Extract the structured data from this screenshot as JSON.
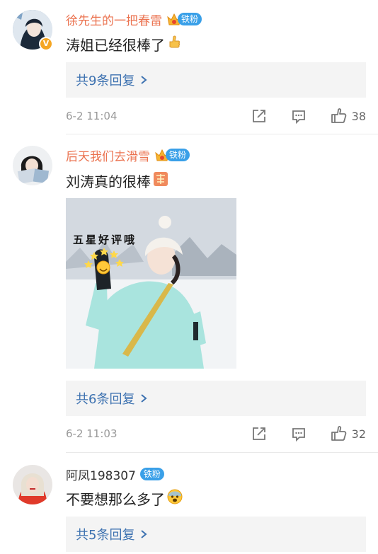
{
  "comments": [
    {
      "username": "徐先生的一把春雷",
      "fan_badge": "铁粉",
      "verified_badge": "V",
      "text": "涛姐已经很棒了",
      "emoji": "thumbs-up",
      "replies_label": "共9条回复",
      "time": "6-2 11:04",
      "likes": "38"
    },
    {
      "username": "后天我们去滑雪",
      "fan_badge": "铁粉",
      "text": "刘涛真的很棒",
      "emoji": "praise-sticker",
      "image_caption": "五星好评哦",
      "replies_label": "共6条回复",
      "time": "6-2 11:03",
      "likes": "32"
    },
    {
      "username": "阿凤198307",
      "fan_badge": "铁粉",
      "text": "不要想那么多了",
      "emoji": "fearful-face",
      "replies_label": "共5条回复"
    }
  ],
  "icons": [
    "repost-icon",
    "comment-icon",
    "like-icon",
    "crown-icon",
    "chevron-right-icon"
  ],
  "colors": {
    "username": "#eb7350",
    "fan_badge": "#3aa0e8",
    "reply_link": "#3c71b0",
    "reply_bg": "#f4f4f4",
    "meta": "#999999"
  }
}
